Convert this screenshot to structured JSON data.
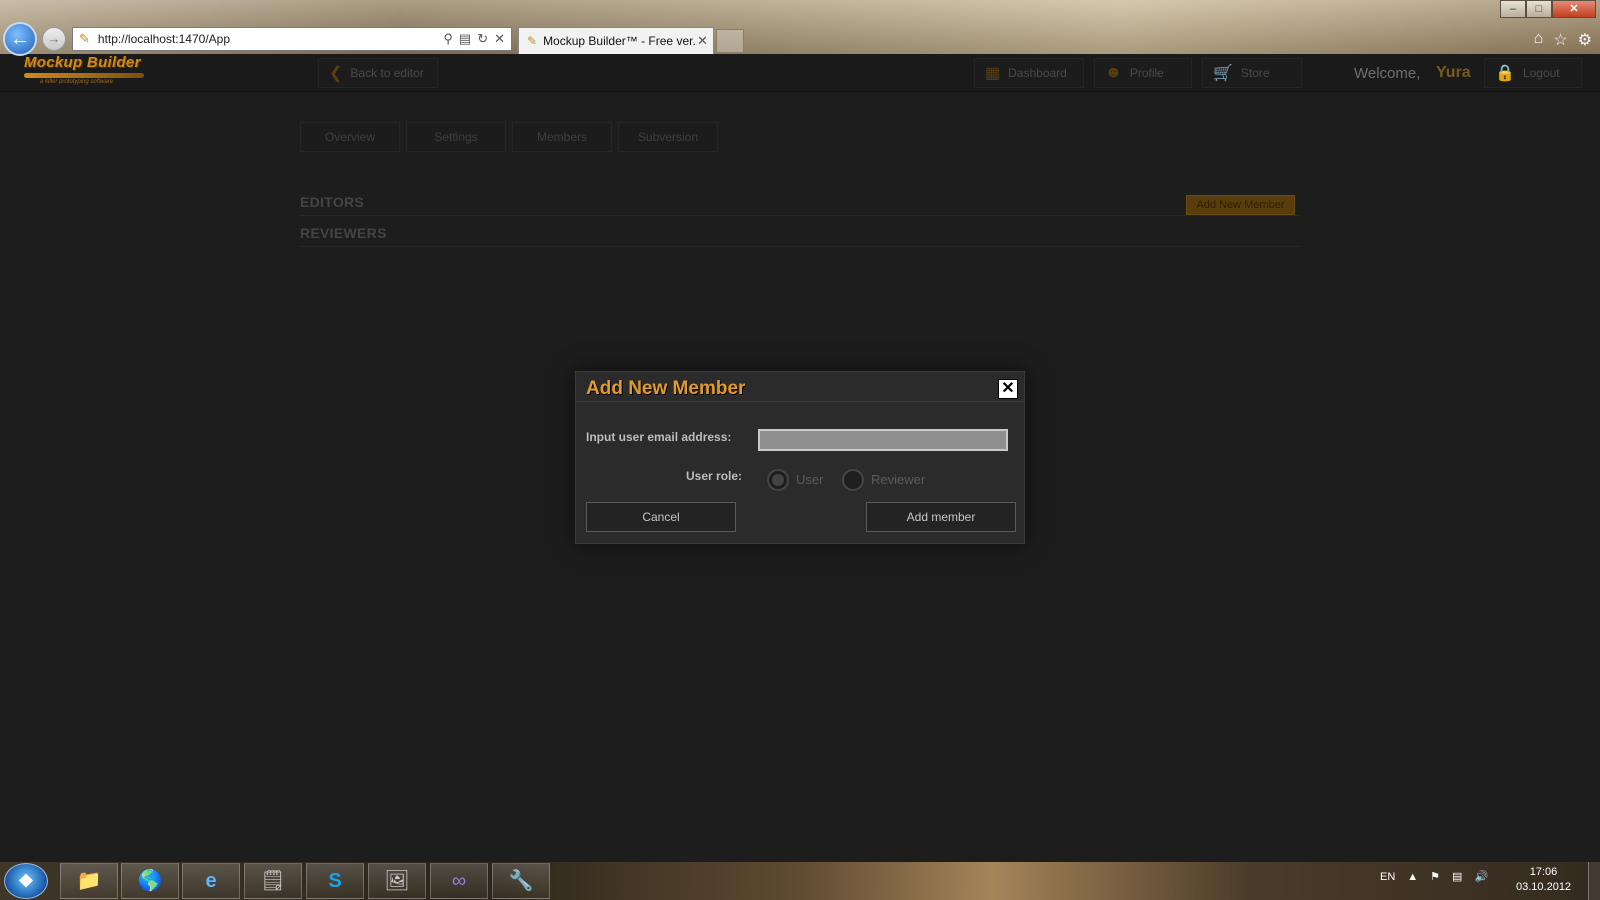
{
  "browser": {
    "url": "http://localhost:1470/App",
    "tab_title": "Mockup Builder™ - Free ver...",
    "window_buttons": [
      "–",
      "□",
      "✕"
    ]
  },
  "app": {
    "logo_text": "Mockup Builder",
    "logo_tagline": "a killer prototyping software",
    "back_label": "Back to editor",
    "nav": [
      {
        "label": "Dashboard",
        "icon": "calendar-icon"
      },
      {
        "label": "Profile",
        "icon": "user-icon"
      },
      {
        "label": "Store",
        "icon": "cart-icon"
      }
    ],
    "welcome_text": "Welcome,",
    "username": "Yura",
    "logout_label": "Logout",
    "accent_color": "#e19a2b"
  },
  "page": {
    "tabs": [
      "Overview",
      "Settings",
      "Members",
      "Subversion"
    ],
    "editors_heading": "EDITORS",
    "reviewers_heading": "REVIEWERS",
    "add_member_button": "Add New Member"
  },
  "dialog": {
    "title": "Add New Member",
    "email_label": "Input user email address:",
    "email_value": "",
    "role_label": "User role:",
    "roles": [
      {
        "label": "User",
        "checked": true
      },
      {
        "label": "Reviewer",
        "checked": false
      }
    ],
    "cancel_label": "Cancel",
    "submit_label": "Add member"
  },
  "taskbar": {
    "language": "EN",
    "time": "17:06",
    "date": "03.10.2012"
  }
}
